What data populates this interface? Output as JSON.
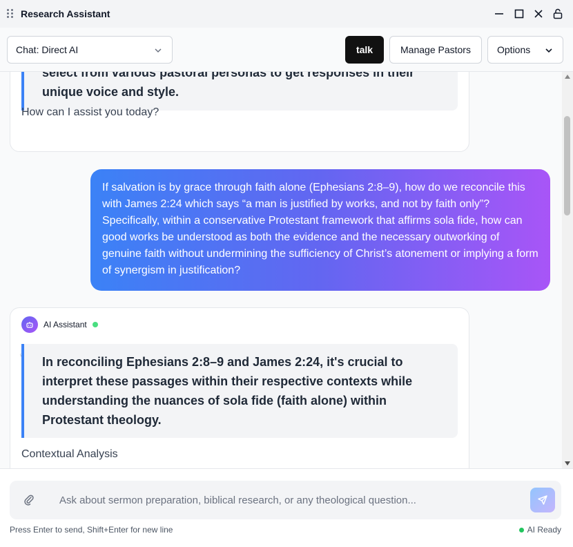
{
  "window": {
    "title": "Research Assistant",
    "controls": [
      "minimize-icon",
      "maximize-icon",
      "close-icon",
      "lock-icon"
    ]
  },
  "toolbar": {
    "chat_mode": "Chat: Direct AI",
    "talk_label": "talk",
    "manage_label": "Manage Pastors",
    "options_label": "Options"
  },
  "messages": {
    "ai_1": {
      "quote": "select from various pastoral personas to get responses in their unique voice and style.",
      "tail": "How can I assist you today?"
    },
    "user_1": {
      "text": "If salvation is by grace through faith alone (Ephesians 2:8–9), how do we reconcile this with James 2:24 which says “a man is justified by works, and not by faith only”? Specifically, within a conservative Protestant framework that affirms sola fide, how can good works be understood as both the evidence and the necessary outworking of genuine faith without undermining the sufficiency of Christ’s atonement or implying a form of synergism in justification?"
    },
    "ai_2": {
      "sender": "AI Assistant",
      "quote": "In reconciling Ephesians 2:8–9 and James 2:24, it's crucial to interpret these passages within their respective contexts while understanding the nuances of sola fide (faith alone) within Protestant theology.",
      "tail": "Contextual Analysis"
    }
  },
  "composer": {
    "placeholder": "Ask about sermon preparation, biblical research, or any theological question...",
    "value": "",
    "hint": "Press Enter to send, Shift+Enter for new line",
    "status": "AI Ready"
  },
  "colors": {
    "accent_blue": "#3b82f6",
    "accent_purple": "#a855f7",
    "status_green": "#22c55e",
    "talk_bg": "#111111"
  }
}
